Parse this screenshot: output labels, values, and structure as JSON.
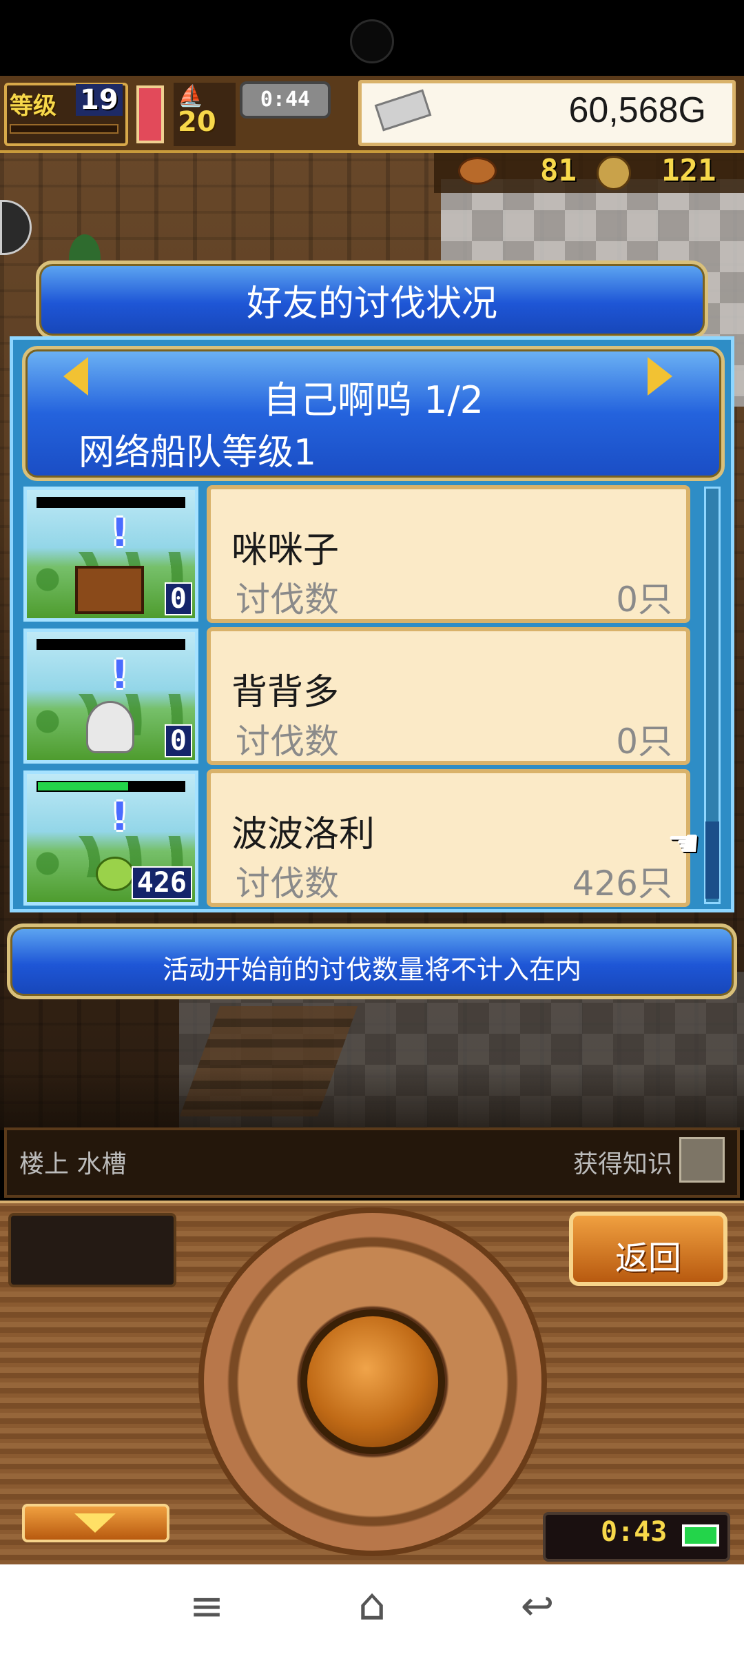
{
  "hud": {
    "level_label": "等级",
    "level_value": "19",
    "boat_icon": "ship-icon",
    "boat_count": "20",
    "timer": "0:44",
    "gold_value": "60,568G",
    "resource1": "81",
    "resource2": "121"
  },
  "dialog": {
    "title": "好友的讨伐状况",
    "player_name": "自己啊呜 1/2",
    "fleet_level": "网络船队等级1",
    "monsters": [
      {
        "name": "咪咪子",
        "kill_label": "讨伐数",
        "kill_count": "0只",
        "badge": "0",
        "hp_fraction": 0.0
      },
      {
        "name": "背背多",
        "kill_label": "讨伐数",
        "kill_count": "0只",
        "badge": "0",
        "hp_fraction": 0.0
      },
      {
        "name": "波波洛利",
        "kill_label": "讨伐数",
        "kill_count": "426只",
        "badge": "426",
        "hp_fraction": 0.62
      }
    ],
    "notice": "活动开始前的讨伐数量将不计入在内"
  },
  "location": {
    "name": "楼上 水槽",
    "knowledge": "获得知识"
  },
  "controls": {
    "back_label": "返回",
    "clock": "0:43"
  },
  "nav": {
    "menu_icon": "≡",
    "home_icon": "⌂",
    "back_icon": "↩"
  },
  "colors": {
    "dialog_blue": "#1e56d6",
    "card_bg": "#fbeac7",
    "gold": "#f2c233"
  }
}
